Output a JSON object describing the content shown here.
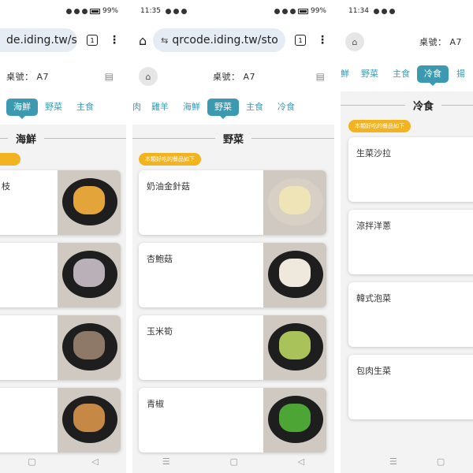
{
  "phones": [
    {
      "status": {
        "time": "",
        "battery": "99%"
      },
      "url": "de.iding.tw/sto",
      "tab_count": "1",
      "table_label": "桌號： A7",
      "tabs": [
        "海鮮",
        "野菜",
        "主食"
      ],
      "active_tab": "海鮮",
      "section_title": "海鮮",
      "notice": "",
      "items": [
        "枝",
        "",
        "",
        ""
      ]
    },
    {
      "status": {
        "time": "11:35",
        "battery": "99%"
      },
      "url": "qrcode.iding.tw/sto",
      "tab_count": "1",
      "table_label": "桌號： A7",
      "tabs": [
        "雞羊",
        "海鮮",
        "野菜",
        "主食",
        "冷食"
      ],
      "active_tab": "野菜",
      "section_title": "野菜",
      "notice": "本類好吃的餐品如下",
      "items": [
        "奶油金針菇",
        "杏鮑菇",
        "玉米筍",
        "青椒"
      ]
    },
    {
      "status": {
        "time": "11:34",
        "battery": ""
      },
      "url": "",
      "tab_count": "",
      "table_label": "桌號： A7",
      "tabs": [
        "鮮",
        "野菜",
        "主食",
        "冷食"
      ],
      "active_tab": "冷食",
      "section_title": "冷食",
      "notice": "本類好吃的餐品如下",
      "items": [
        "生菜沙拉",
        "涼拌洋蔥",
        "韓式泡菜",
        "包肉生菜"
      ]
    }
  ],
  "colors": {
    "accent": "#3b9ab0",
    "notice": "#f2b321",
    "background": "#ffffff",
    "list_bg": "#f3f3f3"
  },
  "icons": {
    "home": "home-icon",
    "tune": "site-settings-icon",
    "menu": "more-vert-icon",
    "receipt": "receipt-icon"
  }
}
